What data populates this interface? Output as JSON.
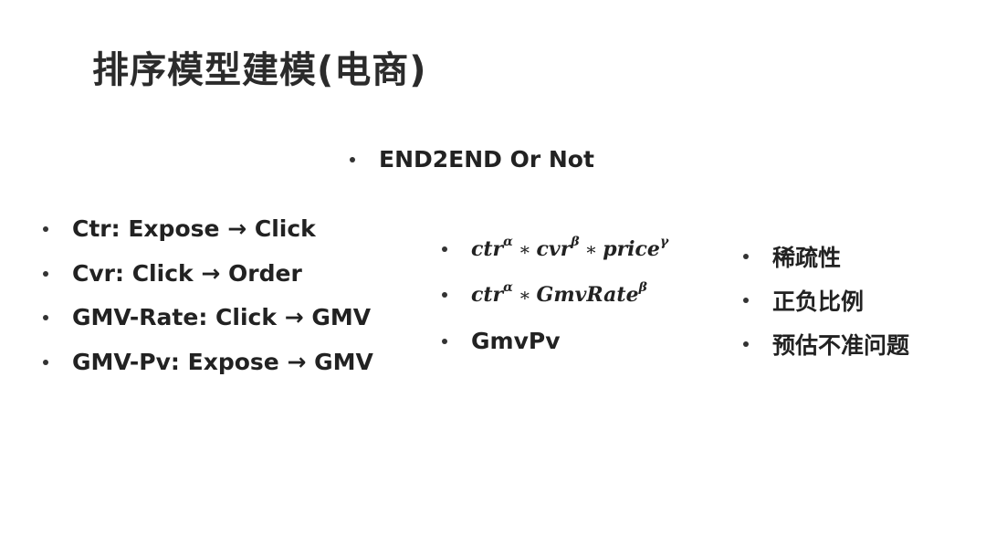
{
  "title": "排序模型建模(电商)",
  "headline": "END2END Or Not",
  "left_list": [
    {
      "label": "Ctr:",
      "from": "Expose",
      "arrow": "→",
      "to": "Click"
    },
    {
      "label": "Cvr:",
      "from": "Click",
      "arrow": "→",
      "to": "Order"
    },
    {
      "label": "GMV-Rate:",
      "from": "Click",
      "arrow": "→",
      "to": "GMV"
    },
    {
      "label": "GMV-Pv:",
      "from": "Expose",
      "arrow": "→",
      "to": "GMV"
    }
  ],
  "formulas": {
    "f1": {
      "t1": "ctr",
      "e1": "α",
      "op1": "∗",
      "t2": "cvr",
      "e2": "β",
      "op2": "∗",
      "t3": "price",
      "e3": "γ"
    },
    "f2": {
      "t1": "ctr",
      "e1": "α",
      "op1": "∗",
      "t2": "GmvRate",
      "e2": "β"
    },
    "f3": "GmvPv"
  },
  "right_list": [
    "稀疏性",
    "正负比例",
    "预估不准问题"
  ]
}
